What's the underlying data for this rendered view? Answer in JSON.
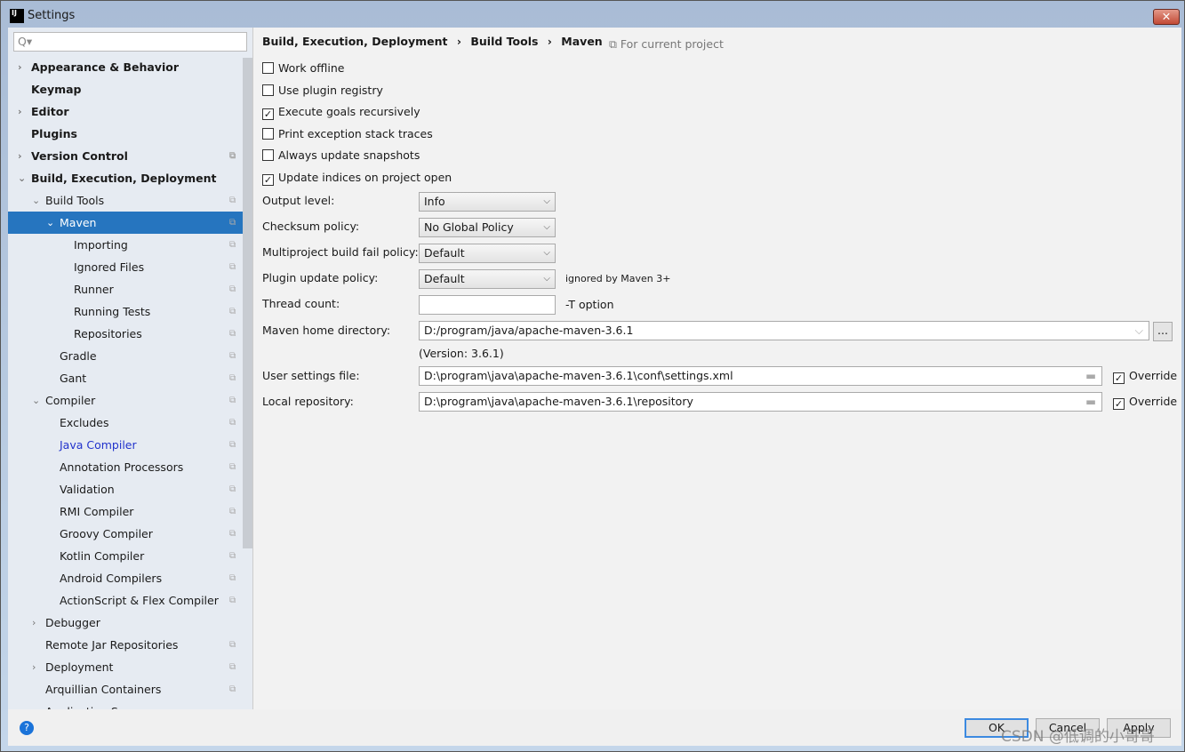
{
  "window": {
    "title": "Settings",
    "close": "✕"
  },
  "search": {
    "placeholder": "Q▾"
  },
  "sidebar": {
    "items": [
      {
        "label": "Appearance & Behavior",
        "level": 0,
        "arrow": "›",
        "bold": true
      },
      {
        "label": "Keymap",
        "level": 0,
        "bold": true
      },
      {
        "label": "Editor",
        "level": 0,
        "arrow": "›",
        "bold": true
      },
      {
        "label": "Plugins",
        "level": 0,
        "bold": true
      },
      {
        "label": "Version Control",
        "level": 0,
        "arrow": "›",
        "bold": true,
        "copy": true
      },
      {
        "label": "Build, Execution, Deployment",
        "level": 0,
        "arrow": "⌄",
        "bold": true
      },
      {
        "label": "Build Tools",
        "level": 1,
        "arrow": "⌄",
        "copy": true
      },
      {
        "label": "Maven",
        "level": 2,
        "arrow": "⌄",
        "copy": true,
        "selected": true
      },
      {
        "label": "Importing",
        "level": 3,
        "copy": true
      },
      {
        "label": "Ignored Files",
        "level": 3,
        "copy": true
      },
      {
        "label": "Runner",
        "level": 3,
        "copy": true
      },
      {
        "label": "Running Tests",
        "level": 3,
        "copy": true
      },
      {
        "label": "Repositories",
        "level": 3,
        "copy": true
      },
      {
        "label": "Gradle",
        "level": 2,
        "copy": true
      },
      {
        "label": "Gant",
        "level": 2,
        "copy": true
      },
      {
        "label": "Compiler",
        "level": 1,
        "arrow": "⌄",
        "copy": true
      },
      {
        "label": "Excludes",
        "level": 2,
        "copy": true
      },
      {
        "label": "Java Compiler",
        "level": 2,
        "copy": true,
        "link": true
      },
      {
        "label": "Annotation Processors",
        "level": 2,
        "copy": true
      },
      {
        "label": "Validation",
        "level": 2,
        "copy": true
      },
      {
        "label": "RMI Compiler",
        "level": 2,
        "copy": true
      },
      {
        "label": "Groovy Compiler",
        "level": 2,
        "copy": true
      },
      {
        "label": "Kotlin Compiler",
        "level": 2,
        "copy": true
      },
      {
        "label": "Android Compilers",
        "level": 2,
        "copy": true
      },
      {
        "label": "ActionScript & Flex Compiler",
        "level": 2,
        "copy": true
      },
      {
        "label": "Debugger",
        "level": 1,
        "arrow": "›"
      },
      {
        "label": "Remote Jar Repositories",
        "level": 1,
        "copy": true
      },
      {
        "label": "Deployment",
        "level": 1,
        "arrow": "›",
        "copy": true
      },
      {
        "label": "Arquillian Containers",
        "level": 1,
        "copy": true
      },
      {
        "label": "Application S",
        "level": 1
      }
    ]
  },
  "breadcrumb": [
    "Build, Execution, Deployment",
    "›",
    "Build Tools",
    "›",
    "Maven"
  ],
  "scope": "⧉ For current project",
  "checkboxes": [
    {
      "label": "Work offline",
      "checked": false
    },
    {
      "label": "Use plugin registry",
      "checked": false
    },
    {
      "label": "Execute goals recursively",
      "checked": true
    },
    {
      "label": "Print exception stack traces",
      "checked": false
    },
    {
      "label": "Always update snapshots",
      "checked": false
    },
    {
      "label": "Update indices on project open",
      "checked": true
    }
  ],
  "form": {
    "output_level": {
      "label": "Output level:",
      "value": "Info"
    },
    "checksum": {
      "label": "Checksum policy:",
      "value": "No Global Policy"
    },
    "multiproject": {
      "label": "Multiproject build fail policy:",
      "value": "Default"
    },
    "plugin_update": {
      "label": "Plugin update policy:",
      "value": "Default",
      "note": "ignored by Maven 3+"
    },
    "thread_count": {
      "label": "Thread count:",
      "value": "",
      "note": "-T option"
    },
    "maven_home": {
      "label": "Maven home directory:",
      "value": "D:/program/java/apache-maven-3.6.1",
      "version": "(Version: 3.6.1)",
      "browse": "..."
    },
    "user_settings": {
      "label": "User settings file:",
      "value": "D:\\program\\java\\apache-maven-3.6.1\\conf\\settings.xml",
      "override": "Override",
      "override_checked": true
    },
    "local_repo": {
      "label": "Local repository:",
      "value": "D:\\program\\java\\apache-maven-3.6.1\\repository",
      "override": "Override",
      "override_checked": true
    }
  },
  "footer": {
    "help": "?",
    "ok": "OK",
    "cancel": "Cancel",
    "apply": "Apply"
  },
  "watermark": "CSDN @低调的小哥哥"
}
